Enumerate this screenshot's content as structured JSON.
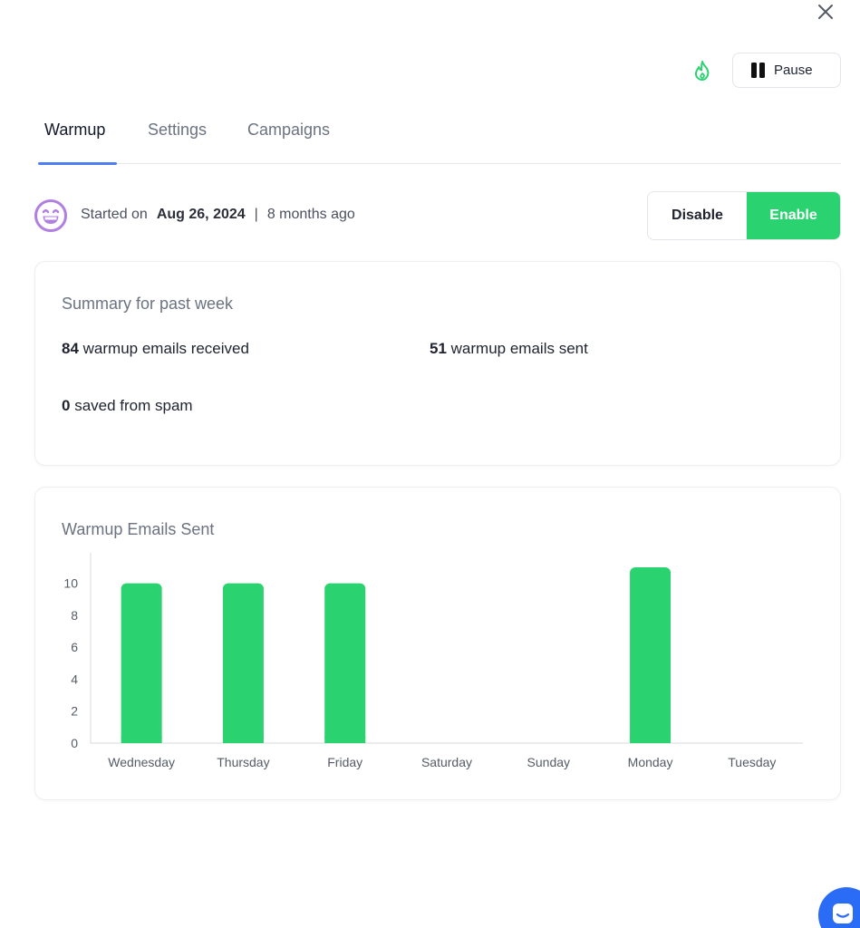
{
  "icons": {
    "close": "close-icon",
    "flame": "flame-icon",
    "pause": "pause-icon",
    "emoji": "grinning-face-icon",
    "chat": "chat-icon"
  },
  "colors": {
    "accent_green": "#2bd270",
    "tab_underline": "#4f7df3",
    "flame": "#2bd270",
    "emoji": "#b07fe0",
    "chat": "#2b6cf6"
  },
  "header": {
    "pause_label": "Pause"
  },
  "tabs": [
    {
      "label": "Warmup",
      "active": true
    },
    {
      "label": "Settings",
      "active": false
    },
    {
      "label": "Campaigns",
      "active": false
    }
  ],
  "status": {
    "started_prefix": "Started on",
    "started_date": "Aug 26, 2024",
    "separator": "|",
    "relative": "8 months ago",
    "disable_label": "Disable",
    "enable_label": "Enable"
  },
  "summary": {
    "title": "Summary for past week",
    "received_count": "84",
    "received_label": "warmup emails received",
    "sent_count": "51",
    "sent_label": "warmup emails sent",
    "spam_count": "0",
    "spam_label": "saved from spam"
  },
  "chart_data": {
    "type": "bar",
    "title": "Warmup Emails Sent",
    "xlabel": "",
    "ylabel": "",
    "categories": [
      "Wednesday",
      "Thursday",
      "Friday",
      "Saturday",
      "Sunday",
      "Monday",
      "Tuesday"
    ],
    "values": [
      10,
      10,
      10,
      0,
      0,
      11,
      0
    ],
    "yticks": [
      0,
      2,
      4,
      6,
      8,
      10
    ],
    "ylim": [
      0,
      11
    ],
    "grid": false,
    "legend": "none",
    "color": "#2bd270"
  }
}
